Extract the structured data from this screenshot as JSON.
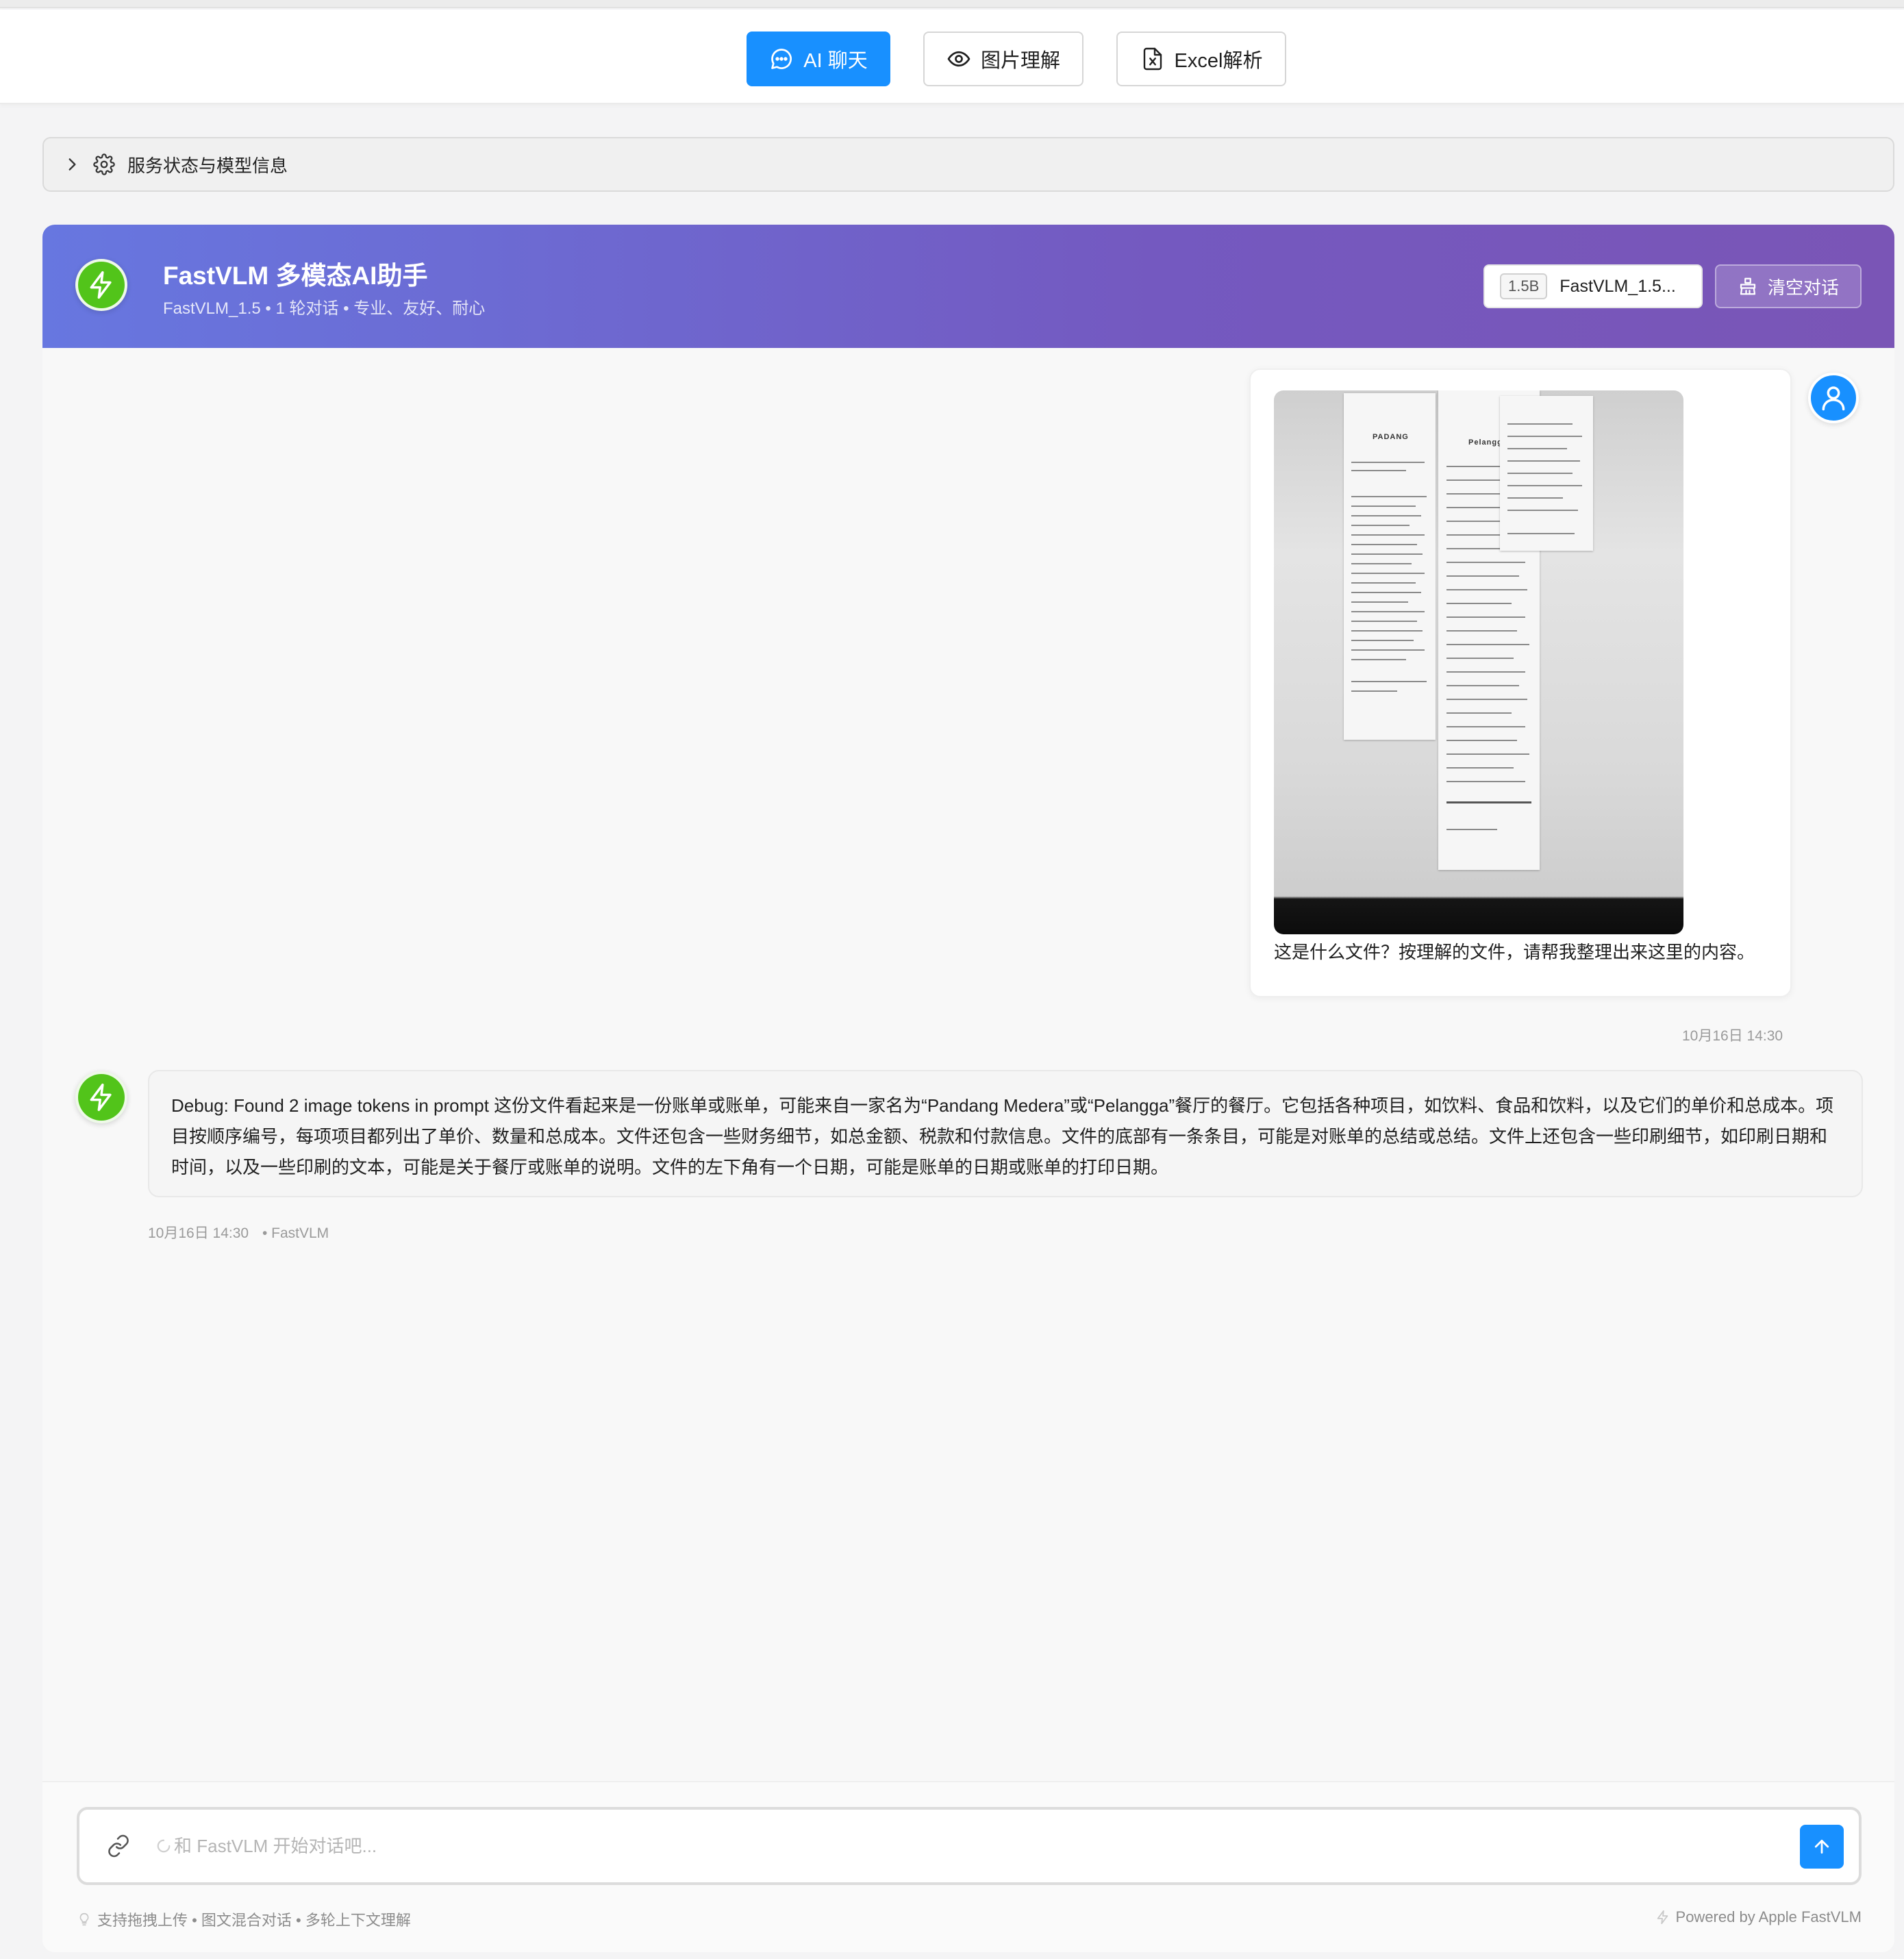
{
  "tabs": [
    {
      "label": "AI 聊天",
      "icon": "chat-bubble-icon",
      "active": true
    },
    {
      "label": "图片理解",
      "icon": "eye-icon",
      "active": false
    },
    {
      "label": "Excel解析",
      "icon": "excel-file-icon",
      "active": false
    }
  ],
  "service_panel": {
    "label": "服务状态与模型信息"
  },
  "chat_header": {
    "title": "FastVLM 多模态AI助手",
    "subtitle": "FastVLM_1.5 • 1 轮对话 • 专业、友好、耐心",
    "model_tag": "1.5B",
    "model_name": "FastVLM_1.5...",
    "clear_label": "清空对话"
  },
  "messages": {
    "user": {
      "text": "这是什么文件？按理解的文件，请帮我整理出来这里的内容。",
      "time": "10月16日 14:30",
      "image": "receipts-photo"
    },
    "assistant": {
      "text": "Debug: Found 2 image tokens in prompt 这份文件看起来是一份账单或账单，可能来自一家名为“Pandang Medera”或“Pelangga”餐厅的餐厅。它包括各种项目，如饮料、食品和饮料，以及它们的单价和总成本。项目按顺序编号，每项项目都列出了单价、数量和总成本。文件还包含一些财务细节，如总金额、税款和付款信息。文件的底部有一条条目，可能是对账单的总结或总结。文件上还包含一些印刷细节，如印刷日期和时间，以及一些印刷的文本，可能是关于餐厅或账单的说明。文件的左下角有一个日期，可能是账单的日期或账单的打印日期。",
      "time": "10月16日 14:30",
      "sender": "• FastVLM"
    }
  },
  "input": {
    "placeholder": "和 FastVLM 开始对话吧...",
    "value": ""
  },
  "footer": {
    "left": "支持拖拽上传 • 图文混合对话 • 多轮上下文理解",
    "right": "Powered by Apple FastVLM"
  },
  "colors": {
    "primary": "#1890ff",
    "header_gradient_start": "#6777e0",
    "header_gradient_end": "#7a55b6",
    "bot_avatar": "#52c41a"
  }
}
